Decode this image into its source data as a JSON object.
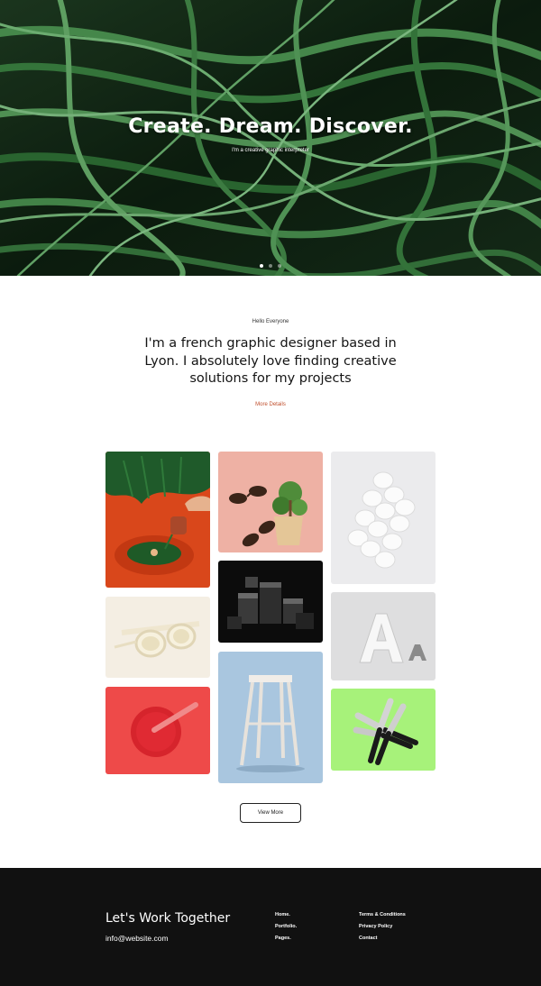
{
  "hero": {
    "title": "Create. Dream. Discover.",
    "subtitle": "I'm a creative graphic interpreter",
    "slides": 3,
    "active_slide": 1
  },
  "intro": {
    "label": "Hello Everyone",
    "text": "I'm a french graphic designer based in Lyon. I absolutely love finding creative solutions for my projects",
    "link": "More Details"
  },
  "gallery": {
    "tiles": [
      {
        "name": "leaf-tea-bowl-image"
      },
      {
        "name": "sunglasses-bonsai-image"
      },
      {
        "name": "eggs-image"
      },
      {
        "name": "white-sunglasses-image"
      },
      {
        "name": "dark-blocks-image"
      },
      {
        "name": "letter-a-image"
      },
      {
        "name": "red-paint-cup-image"
      },
      {
        "name": "white-stool-image"
      },
      {
        "name": "knives-image"
      }
    ],
    "button": "View More"
  },
  "footer": {
    "heading": "Let's Work Together",
    "email": "info@website.com",
    "nav1": [
      "Home.",
      "Portfolio.",
      "Pages."
    ],
    "nav2": [
      "Terms & Conditions",
      "Privacy Policy",
      "Contact"
    ]
  },
  "colors": {
    "accent": "#c0502e",
    "footer_bg": "#111111"
  }
}
